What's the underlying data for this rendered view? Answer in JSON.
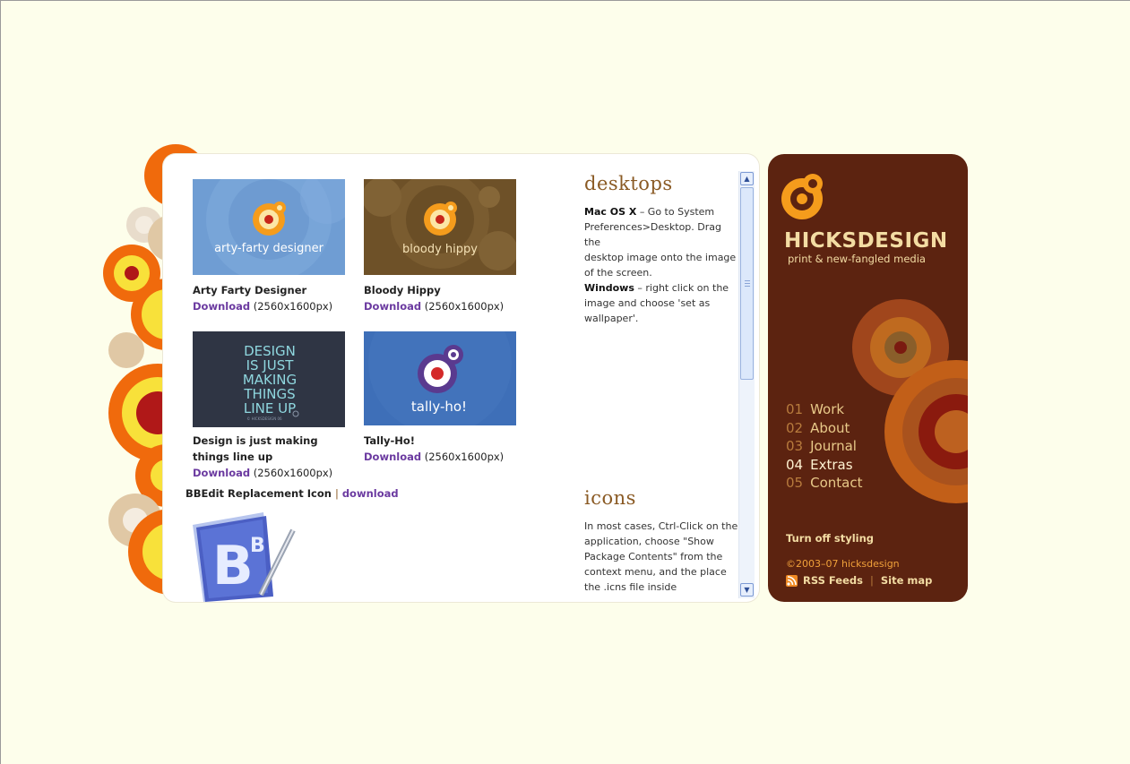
{
  "desktops": {
    "heading": "desktops",
    "items": [
      {
        "title": "Arty Farty Designer",
        "thumb_text": "arty-farty designer",
        "download_label": "Download",
        "size": "(2560x1600px)"
      },
      {
        "title": "Bloody Hippy",
        "thumb_text": "bloody hippy",
        "download_label": "Download",
        "size": "(2560x1600px)"
      },
      {
        "title_line1": "Design is just making",
        "title_line2": "things line up",
        "thumb_lines": [
          "DESIGN",
          "IS JUST",
          "MAKING",
          "THINGS",
          "LINE UP"
        ],
        "thumb_small": "© HICKSDESIGN 06",
        "download_label": "Download",
        "size": "(2560x1600px)"
      },
      {
        "title": "Tally-Ho!",
        "thumb_text": "tally-ho!",
        "download_label": "Download",
        "size": "(2560x1600px)"
      }
    ],
    "mac_label": "Mac OS X",
    "mac_text_lines": [
      "– Go to System",
      "Preferences>Desktop. Drag the",
      "desktop image onto the image",
      "of the screen."
    ],
    "win_label": "Windows",
    "win_text_lines": [
      "– right click on the",
      "image and choose 'set as",
      "wallpaper'."
    ]
  },
  "icons": {
    "heading": "icons",
    "bbedit_label": "BBEdit Replacement Icon",
    "separator": "|",
    "bbedit_download": "download",
    "bbedit_letters": "B",
    "bbedit_super": "B",
    "text_lines": [
      "In most cases, Ctrl-Click on the",
      "application, choose \"Show",
      "Package Contents\" from the",
      "context menu, and the place",
      "the .icns file inside"
    ]
  },
  "sidebar": {
    "brand": "HICKSDESIGN",
    "tagline": "print & new-fangled media",
    "nav": [
      {
        "num": "01",
        "label": "Work"
      },
      {
        "num": "02",
        "label": "About"
      },
      {
        "num": "03",
        "label": "Journal"
      },
      {
        "num": "04",
        "label": "Extras"
      },
      {
        "num": "05",
        "label": "Contact"
      }
    ],
    "active_index": 3,
    "turn_off": "Turn off styling",
    "copyright": "©2003–07 hicksdesign",
    "rss": "RSS Feeds",
    "separator": "|",
    "sitemap": "Site map"
  },
  "colors": {
    "page_bg": "#fdfeeb",
    "sidebar_bg": "#5c2310",
    "link": "#6b3aa0",
    "heading": "#8a5a24"
  }
}
